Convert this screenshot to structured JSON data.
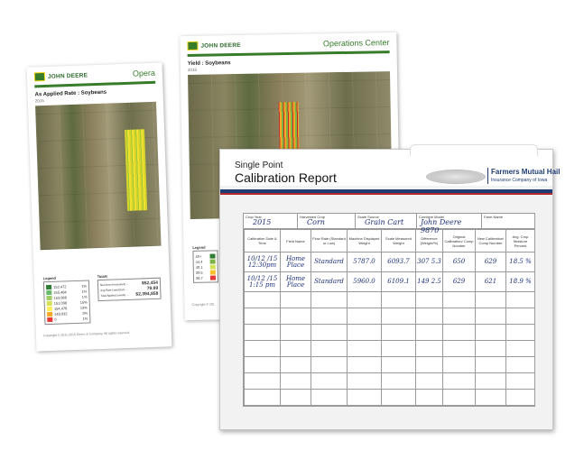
{
  "back_sheet": {
    "brand": "JOHN DEERE",
    "header_right": "Opera",
    "map_title": "As Applied Rate : Soybeans",
    "map_year": "2015",
    "legend_title": "Legend",
    "legend_values": [
      "152,472",
      "155,484",
      "153,888",
      "151,098",
      "154,476",
      "149,032",
      "0"
    ],
    "legend_pcts": [
      "1%",
      "1%",
      "1%",
      "15%",
      "13%",
      "3%",
      "1%"
    ],
    "totals_title": "Totals",
    "totals_labels": [
      "Net Area (measured) ...",
      "Avg Rate (seeds/ac) ...",
      "Total Applied (seeds) ..."
    ],
    "totals_values": [
      "$52,454",
      "79.99",
      "$2,394,858"
    ],
    "copyright": "Copyright © 2011-2015 Deere & Company. All rights reserved."
  },
  "mid_sheet": {
    "brand": "JOHN DEERE",
    "header_right": "Operations Center",
    "map_title": "Yield : Soybeans",
    "map_year": "2015",
    "legend_title": "Legend",
    "legend_values": [
      "40+",
      "44.4",
      "40.1",
      "39.5",
      "36.7"
    ],
    "copyright": "Copyright © 201"
  },
  "report": {
    "title_line1": "Single Point",
    "title_line2": "Calibration Report",
    "company_name": "Farmers Mutual Hail",
    "company_sub": "Insurance Company of Iowa",
    "info_fields": [
      {
        "label": "Crop Year",
        "value": "2015"
      },
      {
        "label": "Harvested Crop",
        "value": "Corn"
      },
      {
        "label": "Scale Source",
        "value": "Grain Cart"
      },
      {
        "label": "Combine Model",
        "value": "John Deere 9870"
      },
      {
        "label": "Farm Name",
        "value": ""
      }
    ],
    "columns": [
      "Calibration Date & Time",
      "Field Name",
      "Flow Rate (Standard or Low)",
      "Machine Displayed Weight",
      "Scale Measured Weight",
      "Difference (Weight/%)",
      "Original Calibration/ Comp Number",
      "New Calibration/ Comp Number",
      "Avg. Crop Moisture Percent"
    ],
    "rows": [
      [
        "10/12 /15 12:30pm",
        "Home Place",
        "Standard",
        "5787.0",
        "6093.7",
        "307 5.3",
        "650",
        "629",
        "18.5 %"
      ],
      [
        "10/12 /15 1:15 pm",
        "Home Place",
        "Standard",
        "5960.0",
        "6109.1",
        "149 2.5",
        "629",
        "621",
        "18.9 %"
      ]
    ],
    "empty_row_count": 7,
    "colors": {
      "rule_blue": "#1f3c73",
      "rule_red": "#b3262a",
      "ink": "#1c2f7a",
      "jd_green": "#367c2b"
    }
  }
}
